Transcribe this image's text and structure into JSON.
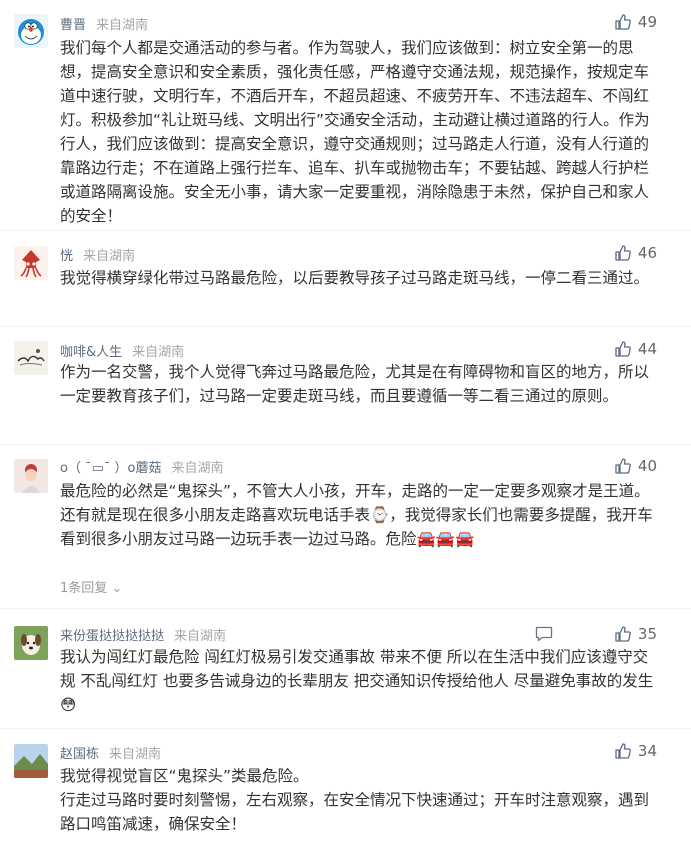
{
  "comments": [
    {
      "username": "曹晋",
      "source": "来自湖南",
      "likes": "49",
      "avatar": "doraemon-avatar",
      "text": "我们每个人都是交通活动的参与者。作为驾驶人，我们应该做到：树立安全第一的思想，提高安全意识和安全素质，强化责任感，严格遵守交通法规，规范操作，按规定车道中速行驶，文明行车，不酒后开车，不超员超速、不疲劳开车、不违法超车、不闯红灯。积极参加“礼让斑马线、文明出行”交通安全活动，主动避让横过道路的行人。作为行人，我们应该做到：提高安全意识，遵守交通规则；过马路走人行道，没有人行道的靠路边行走；不在道路上强行拦车、追车、扒车或抛物击车；不要钻越、跨越人行护栏或道路隔离设施。安全无小事，请大家一定要重视，消除隐患于未然，保护自己和家人的安全！"
    },
    {
      "username": "恍",
      "source": "来自湖南",
      "likes": "46",
      "avatar": "squid-avatar",
      "text": "我觉得横穿绿化带过马路最危险，以后要教导孩子过马路走斑马线，一停二看三通过。"
    },
    {
      "username": "咖啡&人生",
      "source": "来自湖南",
      "likes": "44",
      "avatar": "ink-painting-avatar",
      "text": "作为一名交警，我个人觉得飞奔过马路最危险，尤其是在有障碍物和盲区的地方，所以一定要教育孩子们，过马路一定要走斑马线，而且要遵循一等二看三通过的原则。"
    },
    {
      "username": "o（ ˉ▭ˉ ）o蘑菇",
      "source": "来自湖南",
      "likes": "40",
      "avatar": "child-photo-avatar",
      "text_lines": [
        "最危险的必然是“鬼探头”，不管大人小孩，开车，走路的一定一定要多观察才是王道。",
        "还有就是现在很多小朋友走路喜欢玩电话手表⌚，我觉得家长们也需要多提醒，我开车看到很多小朋友过马路一边玩手表一边过马路。危险🚘🚘🚘"
      ],
      "replies": "1条回复"
    },
    {
      "username": "来份蛋挞挞挞挞挞",
      "source": "来自湖南",
      "likes": "35",
      "avatar": "dog-avatar",
      "text": "我认为闯红灯最危险 闯红灯极易引发交通事故 带来不便 所以在生活中我们应该遵守交规 不乱闯红灯 也要多告诫身边的长辈朋友 把交通知识传授给他人 尽量避免事故的发生😳"
    },
    {
      "username": "赵国栋",
      "source": "来自湖南",
      "likes": "34",
      "avatar": "landscape-avatar",
      "text_lines": [
        "我觉得视觉盲区“鬼探头”类最危险。",
        "行走过马路时要时刻警惕，左右观察，在安全情况下快速通过；开车时注意观察，遇到路口鸣笛减速，确保安全！"
      ]
    }
  ],
  "colors": {
    "username": "#5c6b82",
    "source": "#a6a6a6",
    "text": "#333333",
    "like_icon": "#5a6a84"
  }
}
